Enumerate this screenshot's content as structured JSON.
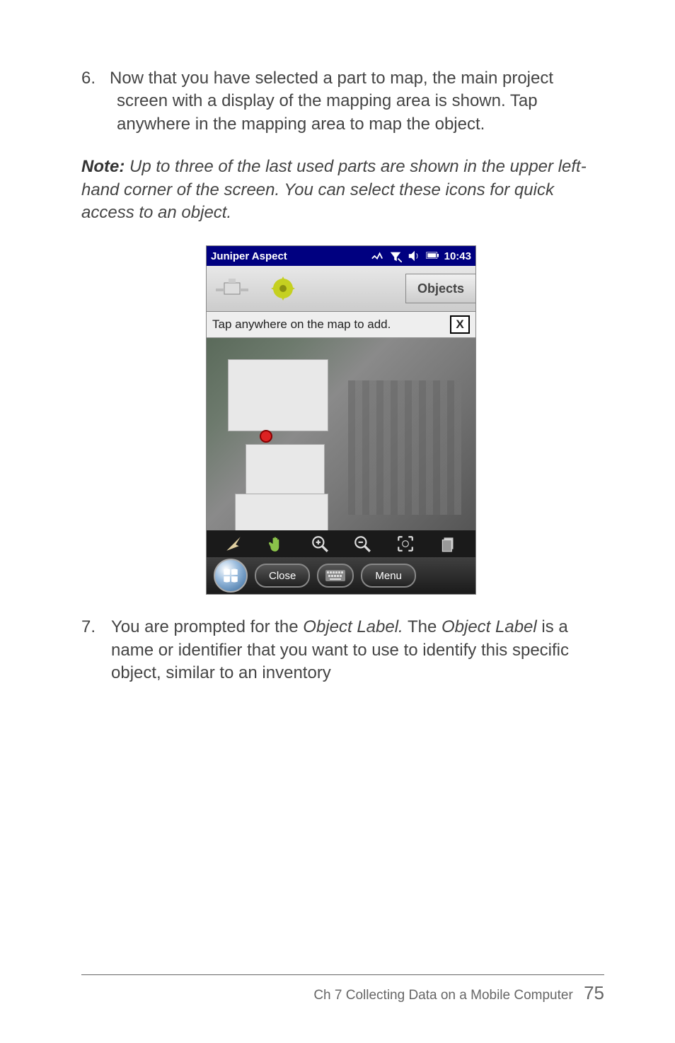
{
  "steps": {
    "s6": {
      "num": "6.",
      "text": "Now that you have selected a part to map, the main project screen with a display of the mapping area is shown. Tap anywhere in the mapping area to map the object."
    },
    "s7": {
      "num": "7.",
      "t1": "You are prompted for the ",
      "em1": "Object Label.",
      "t2": " The ",
      "em2": "Object Label",
      "t3": " is a name or identifier that you want to use to identify this specific object, similar to an inventory"
    }
  },
  "note": {
    "label": "Note:",
    "text": " Up to three of the last used parts are shown in the upper left-hand corner of the screen. You can select these icons for quick access to an object."
  },
  "device": {
    "app_title": "Juniper Aspect",
    "clock": "10:43",
    "objects_label": "Objects",
    "hint_text": "Tap anywhere on the map to add.",
    "hint_close": "X",
    "close_btn": "Close",
    "menu_btn": "Menu"
  },
  "footer": {
    "chapter": "Ch 7   Collecting Data on a Mobile Computer",
    "page": "75"
  }
}
